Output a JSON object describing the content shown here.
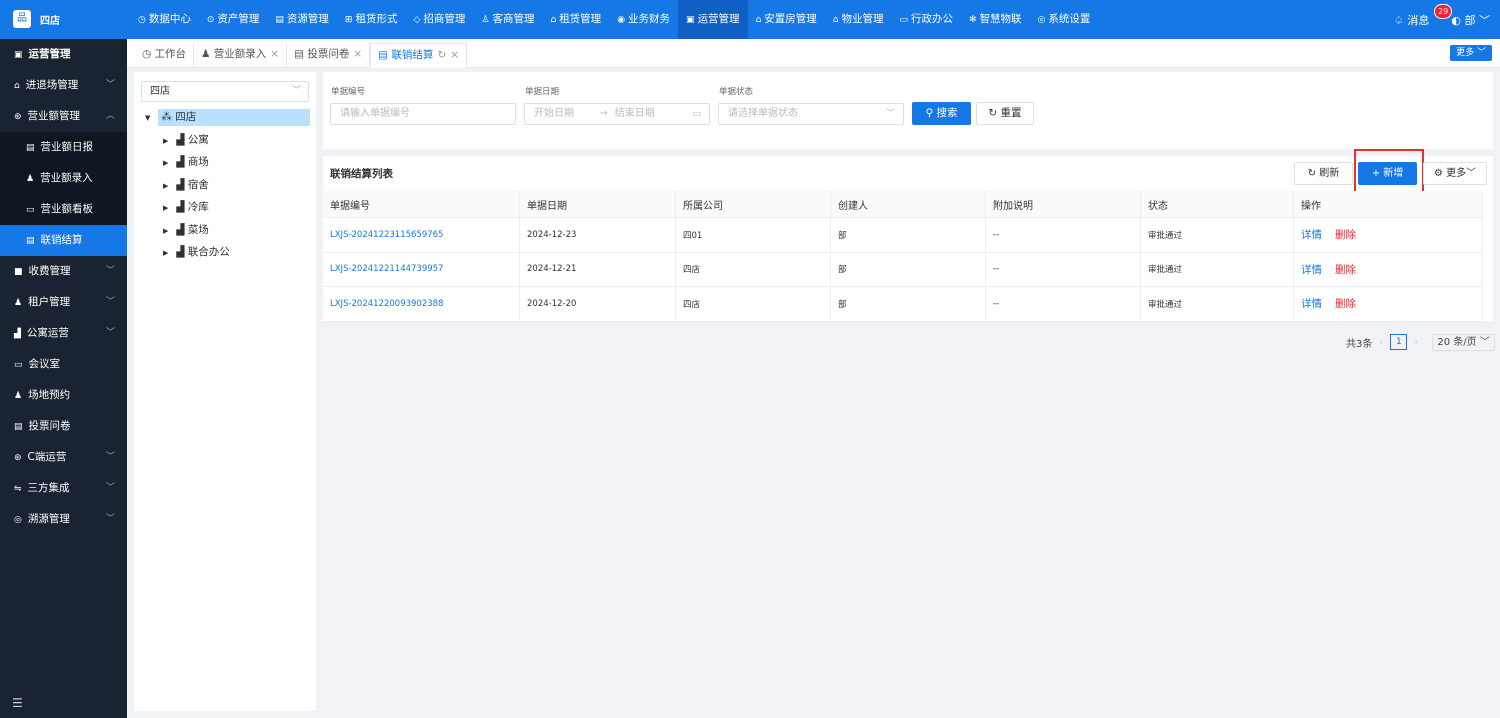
{
  "app": {
    "logo_glyph": "品",
    "name": "四店",
    "accent": "#1677e6"
  },
  "topnav": [
    {
      "icon": "◷",
      "icon_name": "chart-icon",
      "label": "数据中心"
    },
    {
      "icon": "⊙",
      "icon_name": "cube-icon",
      "label": "资产管理"
    },
    {
      "icon": "▤",
      "icon_name": "building-icon",
      "label": "资源管理"
    },
    {
      "icon": "⊞",
      "icon_name": "grid-icon",
      "label": "租赁形式"
    },
    {
      "icon": "◇",
      "icon_name": "tag-icon",
      "label": "招商管理"
    },
    {
      "icon": "♙",
      "icon_name": "users-icon",
      "label": "客商管理"
    },
    {
      "icon": "⌂",
      "icon_name": "house-icon",
      "label": "租赁管理"
    },
    {
      "icon": "◉",
      "icon_name": "coin-icon",
      "label": "业务财务"
    },
    {
      "icon": "▣",
      "icon_name": "operation-icon",
      "label": "运营管理",
      "active": true
    },
    {
      "icon": "⌂",
      "icon_name": "home-icon",
      "label": "安置房管理"
    },
    {
      "icon": "⌂",
      "icon_name": "property-icon",
      "label": "物业管理"
    },
    {
      "icon": "▭",
      "icon_name": "monitor-icon",
      "label": "行政办公"
    },
    {
      "icon": "✻",
      "icon_name": "iot-icon",
      "label": "智慧物联"
    },
    {
      "icon": "◎",
      "icon_name": "settings-icon",
      "label": "系统设置"
    }
  ],
  "topright": {
    "bell_icon": "♤",
    "messages_label": "消息",
    "messages_count": "29",
    "user_icon": "◐",
    "user_name": "部"
  },
  "sidebar": [
    {
      "icon": "▣",
      "label": "运营管理",
      "type": "head"
    },
    {
      "icon": "⌂",
      "label": "进退场管理",
      "arrow": "﹀"
    },
    {
      "icon": "⊛",
      "label": "营业额管理",
      "arrow": "︿"
    },
    {
      "icon": "▤",
      "label": "营业额日报",
      "type": "sub"
    },
    {
      "icon": "♟",
      "label": "营业额录入",
      "type": "sub"
    },
    {
      "icon": "▭",
      "label": "营业额看板",
      "type": "sub"
    },
    {
      "icon": "▤",
      "label": "联销结算",
      "type": "sub",
      "active": true
    },
    {
      "icon": "■",
      "label": "收费管理",
      "arrow": "﹀"
    },
    {
      "icon": "♟",
      "label": "租户管理",
      "arrow": "﹀"
    },
    {
      "icon": "▟",
      "label": "公寓运营",
      "arrow": "﹀"
    },
    {
      "icon": "▭",
      "label": "会议室"
    },
    {
      "icon": "♟",
      "label": "场地预约"
    },
    {
      "icon": "▤",
      "label": "投票问卷"
    },
    {
      "icon": "⊛",
      "label": "C端运营",
      "arrow": "﹀"
    },
    {
      "icon": "⇋",
      "label": "三方集成",
      "arrow": "﹀"
    },
    {
      "icon": "◎",
      "label": "溯源管理",
      "arrow": "﹀"
    }
  ],
  "sidebar_toggle": "☰",
  "tabs": [
    {
      "icon": "◷",
      "label": "工作台",
      "closable": false
    },
    {
      "icon": "♟",
      "label": "营业额录入",
      "closable": true
    },
    {
      "icon": "▤",
      "label": "投票问卷",
      "closable": true
    },
    {
      "icon": "▤",
      "label": "联销结算",
      "closable": true,
      "active": true,
      "refresh": "↻"
    }
  ],
  "tab_close": "×",
  "tabbar_more": "更多 ﹀",
  "tree": {
    "select_value": "四店",
    "root": {
      "icon": "⁂",
      "label": "四店"
    },
    "children": [
      {
        "icon": "▟",
        "label": "公寓"
      },
      {
        "icon": "▟",
        "label": "商场"
      },
      {
        "icon": "▟",
        "label": "宿舍"
      },
      {
        "icon": "▟",
        "label": "冷库"
      },
      {
        "icon": "▟",
        "label": "菜场"
      },
      {
        "icon": "▟",
        "label": "联合办公"
      }
    ]
  },
  "search": {
    "doc_no_label": "单据编号",
    "doc_no_placeholder": "请输入单据编号",
    "date_label": "单据日期",
    "date_start_placeholder": "开始日期",
    "date_sep": "→",
    "date_end_placeholder": "结束日期",
    "calendar_icon": "▭",
    "status_label": "单据状态",
    "status_placeholder": "请选择单据状态",
    "search_button": "⚲ 搜索",
    "reset_button": "↻ 重置"
  },
  "list": {
    "title": "联销结算列表",
    "refresh_button": "↻ 刷新",
    "add_button": "+ 新增",
    "more_button": "⚙ 更多﹀",
    "columns": [
      "单据编号",
      "单据日期",
      "所属公司",
      "创建人",
      "附加说明",
      "状态",
      "操作"
    ],
    "rows": [
      {
        "no": "LXJS-20241223115659765",
        "date": "2024-12-23",
        "company": "四01",
        "creator": "部",
        "note": "--",
        "status": "审批通过",
        "detail": "详情",
        "delete": "删除"
      },
      {
        "no": "LXJS-20241221144739957",
        "date": "2024-12-21",
        "company": "四店",
        "creator": "部",
        "note": "--",
        "status": "审批通过",
        "detail": "详情",
        "delete": "删除"
      },
      {
        "no": "LXJS-20241220093902388",
        "date": "2024-12-20",
        "company": "四店",
        "creator": "部",
        "note": "--",
        "status": "审批通过",
        "detail": "详情",
        "delete": "删除"
      }
    ]
  },
  "pager": {
    "total": "共3条",
    "prev": "‹",
    "current": "1",
    "next": "›",
    "page_size": "20 条/页 ﹀"
  }
}
